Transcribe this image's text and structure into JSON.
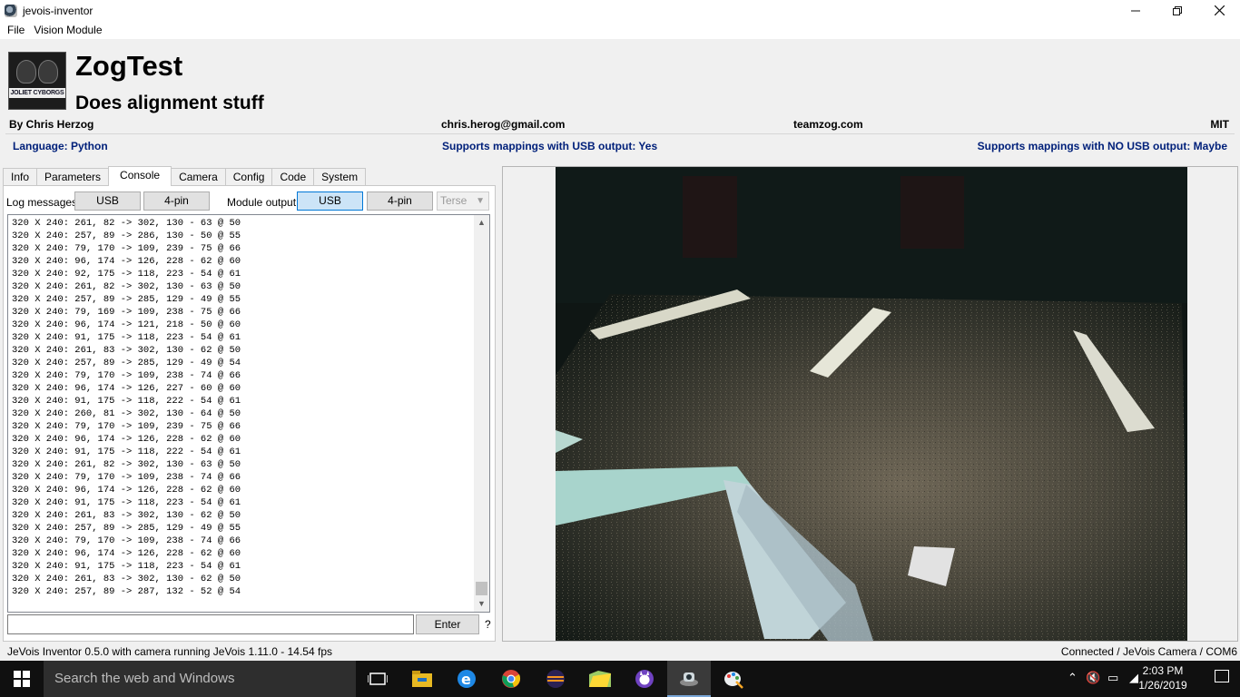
{
  "window": {
    "title": "jevois-inventor"
  },
  "menu": [
    "File",
    "Vision Module"
  ],
  "module": {
    "name": "ZogTest",
    "description": "Does alignment stuff",
    "logo_text": "JOLIET CYBORGS",
    "author": "By Chris Herzog",
    "email": "chris.herog@gmail.com",
    "website": "teamzog.com",
    "license": "MIT",
    "language": "Language: Python",
    "usb_mappings": "Supports mappings with USB output: Yes",
    "nousb_mappings": "Supports mappings with NO USB output: Maybe"
  },
  "tabs": [
    "Info",
    "Parameters",
    "Console",
    "Camera",
    "Config",
    "Code",
    "System"
  ],
  "active_tab": "Console",
  "console": {
    "log_label": "Log messages:",
    "log_usb": "USB",
    "log_4pin": "4-pin",
    "module_output_label": "Module output:",
    "out_usb": "USB",
    "out_4pin": "4-pin",
    "verbosity": "Terse",
    "enter_label": "Enter",
    "help": "?",
    "command_value": "",
    "lines": [
      "320 X 240: 261, 82 -> 302, 130 - 63 @ 50",
      "320 X 240: 257, 89 -> 286, 130 - 50 @ 55",
      "320 X 240: 79, 170 -> 109, 239 - 75 @ 66",
      "320 X 240: 96, 174 -> 126, 228 - 62 @ 60",
      "320 X 240: 92, 175 -> 118, 223 - 54 @ 61",
      "320 X 240: 261, 82 -> 302, 130 - 63 @ 50",
      "320 X 240: 257, 89 -> 285, 129 - 49 @ 55",
      "320 X 240: 79, 169 -> 109, 238 - 75 @ 66",
      "320 X 240: 96, 174 -> 121, 218 - 50 @ 60",
      "320 X 240: 91, 175 -> 118, 223 - 54 @ 61",
      "320 X 240: 261, 83 -> 302, 130 - 62 @ 50",
      "320 X 240: 257, 89 -> 285, 129 - 49 @ 54",
      "320 X 240: 79, 170 -> 109, 238 - 74 @ 66",
      "320 X 240: 96, 174 -> 126, 227 - 60 @ 60",
      "320 X 240: 91, 175 -> 118, 222 - 54 @ 61",
      "320 X 240: 260, 81 -> 302, 130 - 64 @ 50",
      "320 X 240: 79, 170 -> 109, 239 - 75 @ 66",
      "320 X 240: 96, 174 -> 126, 228 - 62 @ 60",
      "320 X 240: 91, 175 -> 118, 222 - 54 @ 61",
      "320 X 240: 261, 82 -> 302, 130 - 63 @ 50",
      "320 X 240: 79, 170 -> 109, 238 - 74 @ 66",
      "320 X 240: 96, 174 -> 126, 228 - 62 @ 60",
      "320 X 240: 91, 175 -> 118, 223 - 54 @ 61",
      "320 X 240: 261, 83 -> 302, 130 - 62 @ 50",
      "320 X 240: 257, 89 -> 285, 129 - 49 @ 55",
      "320 X 240: 79, 170 -> 109, 238 - 74 @ 66",
      "320 X 240: 96, 174 -> 126, 228 - 62 @ 60",
      "320 X 240: 91, 175 -> 118, 223 - 54 @ 61",
      "320 X 240: 261, 83 -> 302, 130 - 62 @ 50",
      "320 X 240: 257, 89 -> 287, 132 - 52 @ 54"
    ]
  },
  "status": {
    "left": "JeVois Inventor 0.5.0 with camera running JeVois 1.11.0 - 14.54 fps",
    "right": "Connected / JeVois Camera / COM6"
  },
  "taskbar": {
    "search_placeholder": "Search the web and Windows",
    "time": "2:03 PM",
    "date": "1/26/2019",
    "apps": [
      "task-view-icon",
      "file-explorer-icon",
      "edge-icon",
      "chrome-icon",
      "eclipse-icon",
      "folder-app-icon",
      "github-desktop-icon",
      "jevois-inventor-icon",
      "paint-icon"
    ]
  },
  "colors": {
    "accent": "#0078d7",
    "info_blue": "#00207a",
    "taskbar": "#101010"
  }
}
